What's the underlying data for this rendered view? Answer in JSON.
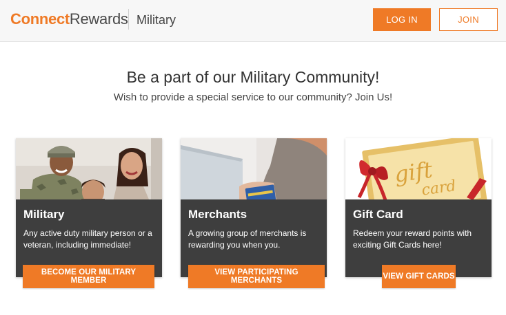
{
  "header": {
    "logo_part1": "Connect",
    "logo_part2": "Rewards",
    "section": "Military",
    "login_label": "LOG IN",
    "join_label": "JOIN"
  },
  "hero": {
    "title": "Be a part of our Military Community!",
    "subtitle": "Wish to provide a special service to our community? Join Us!"
  },
  "cards": [
    {
      "title": "Military",
      "text": "Any active duty military person or a veteran, including immediate!",
      "button": "BECOME OUR MILITARY MEMBER",
      "image": "military-family-photo"
    },
    {
      "title": "Merchants",
      "text": "A growing group of merchants is rewarding you when you.",
      "button": "VIEW PARTICIPATING MERCHANTS",
      "image": "credit-card-laptop-photo"
    },
    {
      "title": "Gift Card",
      "text": "Redeem your reward points with exciting Gift Cards here!",
      "button": "VIEW GIFT CARDS",
      "image": "gift-card-ribbon-photo"
    }
  ],
  "gift_card_image_text": [
    "gift",
    "card"
  ],
  "colors": {
    "accent": "#ef7a26",
    "panel": "#3e3e3e",
    "header_bg": "#f7f7f7"
  }
}
